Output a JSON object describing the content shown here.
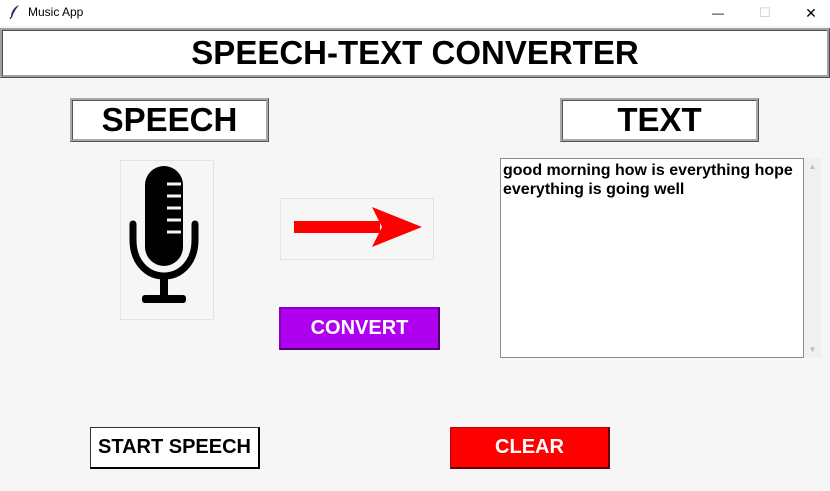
{
  "window": {
    "title": "Music App",
    "minimize_glyph": "—",
    "maximize_glyph": "☐",
    "close_glyph": "✕"
  },
  "header": {
    "title": "SPEECH-TEXT CONVERTER"
  },
  "speech_label": "SPEECH",
  "text_label": "TEXT",
  "buttons": {
    "convert": "CONVERT",
    "start_speech": "START SPEECH",
    "clear": "CLEAR"
  },
  "output": {
    "text": "good morning how is everything hope everything is going well"
  },
  "icons": {
    "app": "feather-icon",
    "mic": "microphone-icon",
    "arrow": "right-arrow-icon"
  },
  "colors": {
    "convert_bg": "#b000f0",
    "clear_bg": "#ff0000",
    "arrow": "#ff0000"
  }
}
